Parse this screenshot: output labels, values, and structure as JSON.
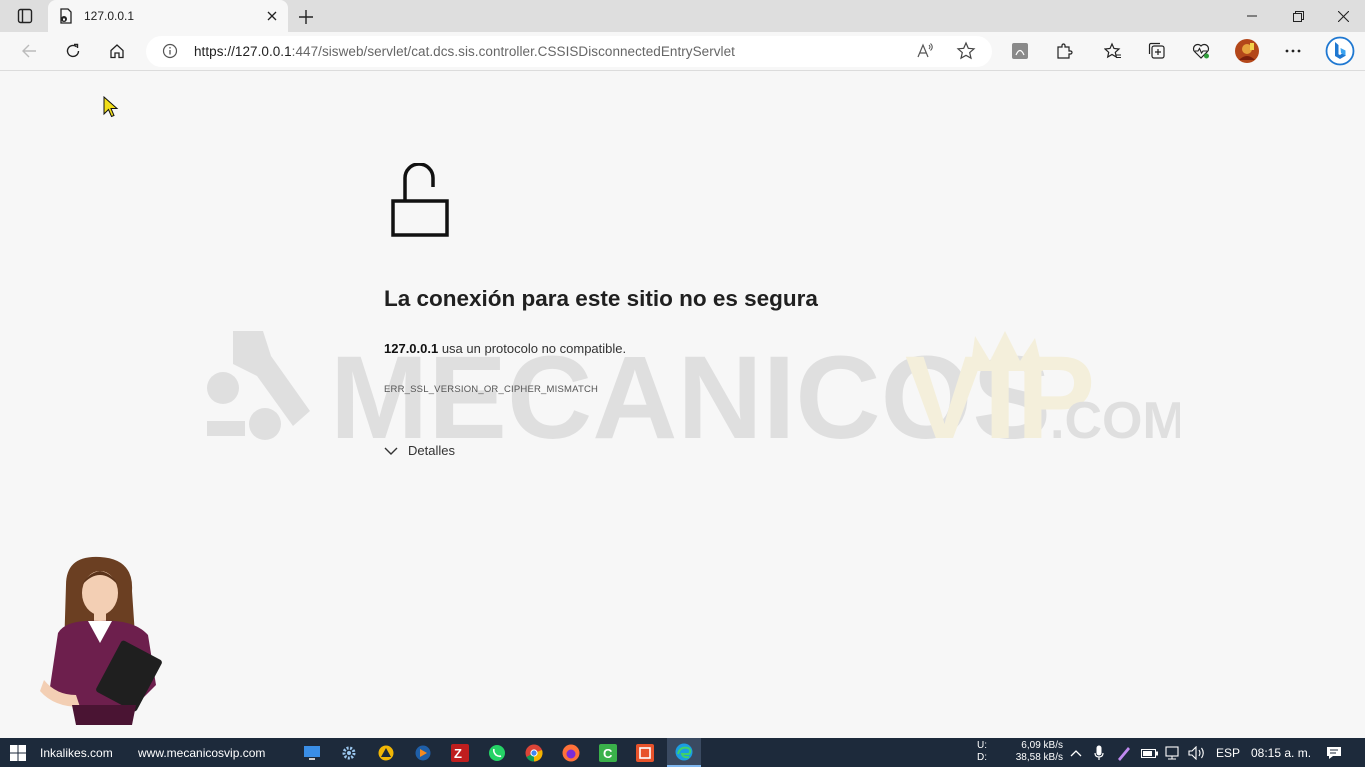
{
  "browser": {
    "tab_title": "127.0.0.1",
    "url_host": "https://127.0.0.1",
    "url_rest": ":447/sisweb/servlet/cat.dcs.sis.controller.CSSISDisconnectedEntryServlet"
  },
  "error_page": {
    "heading": "La conexión para este sitio no es segura",
    "host_bold": "127.0.0.1",
    "description_rest": " usa un protocolo no compatible.",
    "error_code": "ERR_SSL_VERSION_OR_CIPHER_MISMATCH",
    "details_label": "Detalles"
  },
  "watermark": {
    "text_main": "MECANICOS",
    "text_vip": "VIP",
    "text_com": ".COM"
  },
  "taskbar": {
    "label_1": "Inkalikes.com",
    "label_2": "www.mecanicosvip.com",
    "upload_label": "U:",
    "upload_rate": "6,09 kB/s",
    "download_label": "D:",
    "download_rate": "38,58 kB/s",
    "language": "ESP",
    "time": "08:15 a. m."
  },
  "icons": [
    "tab-actions-icon",
    "secure-doc-icon",
    "close-icon",
    "plus-icon",
    "minimize-icon",
    "restore-icon",
    "back-icon",
    "refresh-icon",
    "home-icon",
    "info-icon",
    "read-aloud-icon",
    "star-icon",
    "pdf-icon",
    "extensions-icon",
    "favorites-icon",
    "collections-icon",
    "heart-pulse-icon",
    "profile-icon",
    "more-icon",
    "bing-icon",
    "lock-open-icon",
    "chevron-down-icon",
    "windows-icon",
    "microphone-icon",
    "pen-icon",
    "battery-icon",
    "network-icon",
    "volume-icon",
    "notification-icon"
  ],
  "colors": {
    "chrome": "#dedede",
    "page": "#f7f7f7",
    "taskbar": "#1d2a3b",
    "watermark_vip": "#e8c94f"
  }
}
